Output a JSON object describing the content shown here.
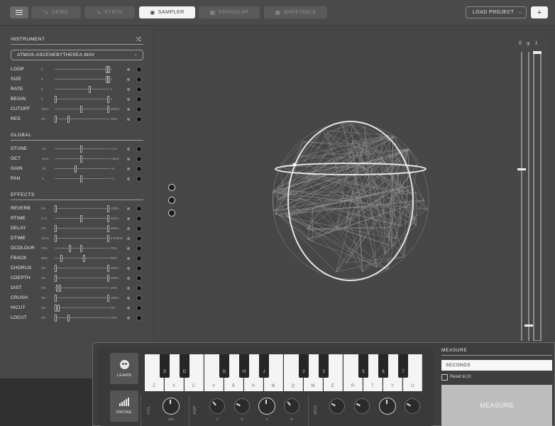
{
  "topbar": {
    "tabs": [
      {
        "label": "DEMO",
        "icon": "waveform-icon"
      },
      {
        "label": "SYNTH",
        "icon": "waveform-icon"
      },
      {
        "label": "SAMPLER",
        "icon": "disc-icon"
      },
      {
        "label": "GRANULAR",
        "icon": "grid-icon"
      },
      {
        "label": "WAVETABLE",
        "icon": "grid-icon"
      }
    ],
    "active_tab": "SAMPLER",
    "load_project": "LOAD PROJECT",
    "plus": "+"
  },
  "instrument": {
    "title": "INSTRUMENT",
    "file": "ATMOS-ASCENEBYTHESEA.WAV",
    "params": [
      {
        "label": "LOOP",
        "min": "0",
        "max": "1"
      },
      {
        "label": "SIZE",
        "min": "0",
        "max": "1"
      },
      {
        "label": "RATE",
        "min": "0",
        "max": "1"
      },
      {
        "label": "BEGIN",
        "min": "0",
        "max": "1"
      },
      {
        "label": "CUTOFF",
        "min": "10Hz",
        "max": "20kHz"
      },
      {
        "label": "RES",
        "min": "0%",
        "max": "10%"
      }
    ]
  },
  "global": {
    "title": "GLOBAL",
    "params": [
      {
        "label": "DTUNE",
        "min": "-1ct",
        "max": "+1ct"
      },
      {
        "label": "OCT",
        "min": "-2oct",
        "max": "+2oct"
      },
      {
        "label": "GAIN",
        "min": "-inf",
        "max": "+6"
      },
      {
        "label": "PAN",
        "min": "-1",
        "max": "+1"
      }
    ]
  },
  "effects": {
    "title": "EFFECTS",
    "params": [
      {
        "label": "REVERB",
        "min": "0%",
        "max": "100%"
      },
      {
        "label": "RTIME",
        "min": "0.1s",
        "max": "100%"
      },
      {
        "label": "DELAY",
        "min": "0%",
        "max": "100%"
      },
      {
        "label": "DTIME",
        "min": "10ms",
        "max": "5.000ms"
      },
      {
        "label": "DCOLOUR",
        "min": "25%",
        "max": "75%"
      },
      {
        "label": "FBACK",
        "min": "45%",
        "max": "95%"
      },
      {
        "label": "CHORUS",
        "min": "0%",
        "max": "100%"
      },
      {
        "label": "CDEPTH",
        "min": "0%",
        "max": "100%"
      },
      {
        "label": "DIST",
        "min": "0%",
        "max": "10%"
      },
      {
        "label": "CRUSH",
        "min": "0%",
        "max": "100%"
      },
      {
        "label": "HICUT",
        "min": "0%",
        "max": "0%"
      },
      {
        "label": "LOCUT",
        "min": "0%",
        "max": "10%"
      }
    ]
  },
  "viewport": {
    "slider_icons": [
      "θ",
      "φ",
      "λ"
    ]
  },
  "keyboard": {
    "learn": "LEARN",
    "drone": "DRONE",
    "white_keys": [
      "Z",
      "X",
      "C",
      "V",
      "B",
      "N",
      "M",
      "Q",
      "W",
      "E",
      "R",
      "T",
      "Y",
      "U"
    ],
    "black_keys": [
      "S",
      "D",
      "G",
      "H",
      "J",
      "2",
      "3",
      "5",
      "6",
      "7"
    ],
    "vol_label": "VOL",
    "vol_sub": "VOL",
    "amp_label": "AMP",
    "amp_subs": [
      "A",
      "D",
      "S",
      "R"
    ],
    "mod_label": "MOD"
  },
  "measure": {
    "title": "MEASURE",
    "unit": "SECONDS",
    "reset_label": "Reset to |0:",
    "button": "MEASURE"
  }
}
